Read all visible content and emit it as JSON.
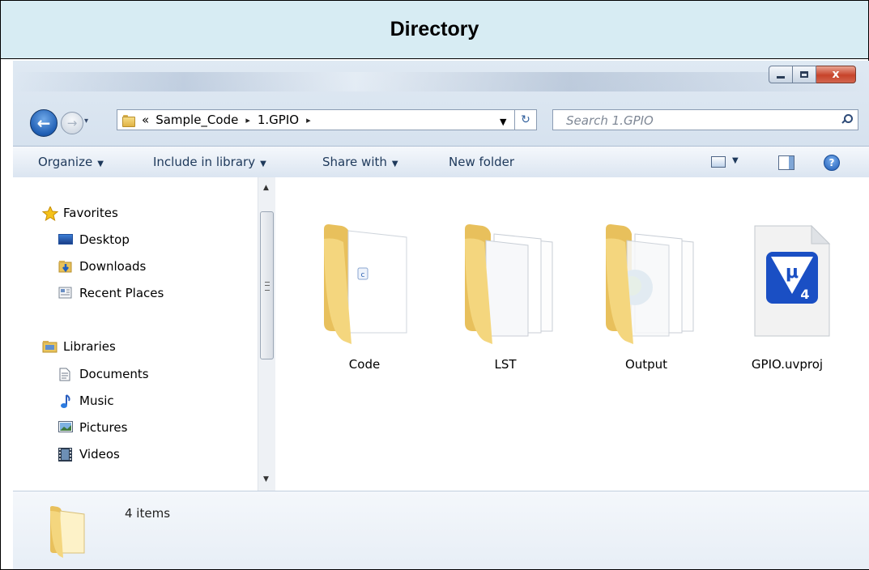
{
  "caption": {
    "title": "Directory"
  },
  "window": {
    "buttons": {
      "minimize": "",
      "maximize": "",
      "close": "x"
    }
  },
  "nav": {
    "back_glyph": "←",
    "forward_glyph": "→",
    "breadcrumb_overflow": "«",
    "breadcrumb": [
      "Sample_Code",
      "1.GPIO"
    ],
    "crumb_arrow": "▸",
    "dropdown_glyph": "▾",
    "refresh_glyph": "↻"
  },
  "search": {
    "placeholder": "Search 1.GPIO"
  },
  "toolbar": {
    "organize": "Organize",
    "include_in_library": "Include in library",
    "share_with": "Share with",
    "new_folder": "New folder",
    "arrow": "▼",
    "help": "?"
  },
  "sidebar": {
    "favorites_header": "Favorites",
    "favorites": [
      "Desktop",
      "Downloads",
      "Recent Places"
    ],
    "libraries_header": "Libraries",
    "libraries": [
      "Documents",
      "Music",
      "Pictures",
      "Videos"
    ]
  },
  "files": [
    {
      "name": "Code",
      "type": "folder"
    },
    {
      "name": "LST",
      "type": "folder"
    },
    {
      "name": "Output",
      "type": "folder"
    },
    {
      "name": "GPIO.uvproj",
      "type": "uvision-project"
    }
  ],
  "file_badges": {
    "code_doc": "c",
    "uv_logo": "μ",
    "uv_version": "4"
  },
  "status": {
    "count": "4 items"
  },
  "colors": {
    "caption_bg": "#d7ecf3",
    "folder": "#f2cf6e",
    "uv_blue": "#1a4fc4"
  }
}
